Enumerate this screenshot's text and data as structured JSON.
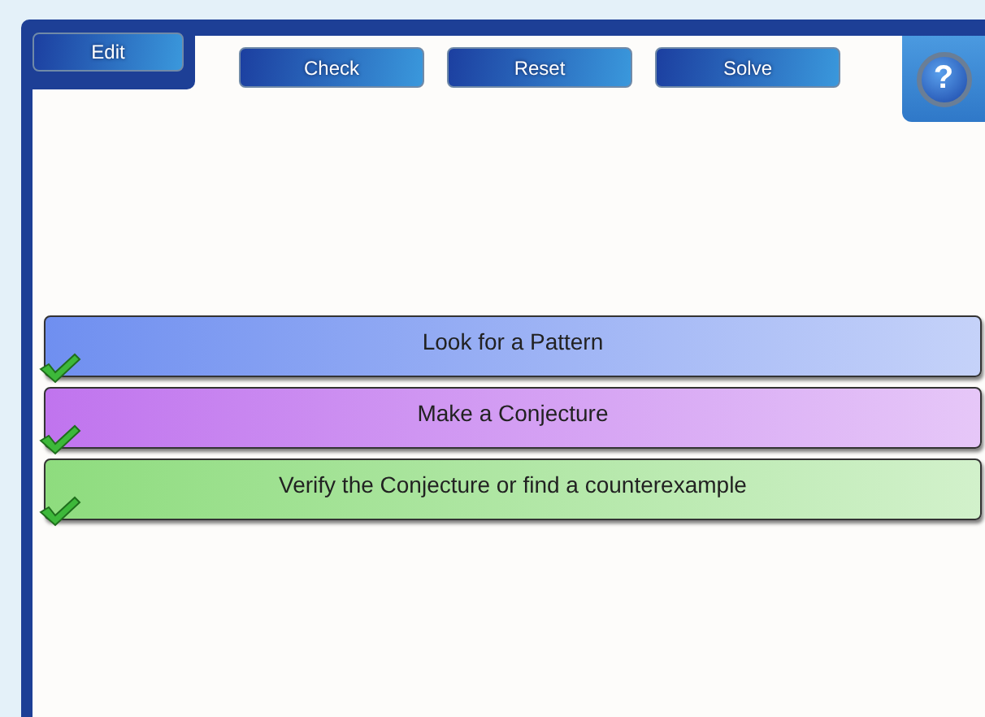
{
  "toolbar": {
    "edit": "Edit",
    "buttons": [
      "Check",
      "Reset",
      "Solve"
    ],
    "help": "?"
  },
  "steps": [
    {
      "label": "Look for a Pattern",
      "color": "#6f8ff0",
      "checked": true
    },
    {
      "label": "Make a Conjecture",
      "color": "#c074ee",
      "checked": true
    },
    {
      "label": "Verify the Conjecture or find a counterexample",
      "color": "#8edc7e",
      "checked": true
    }
  ]
}
